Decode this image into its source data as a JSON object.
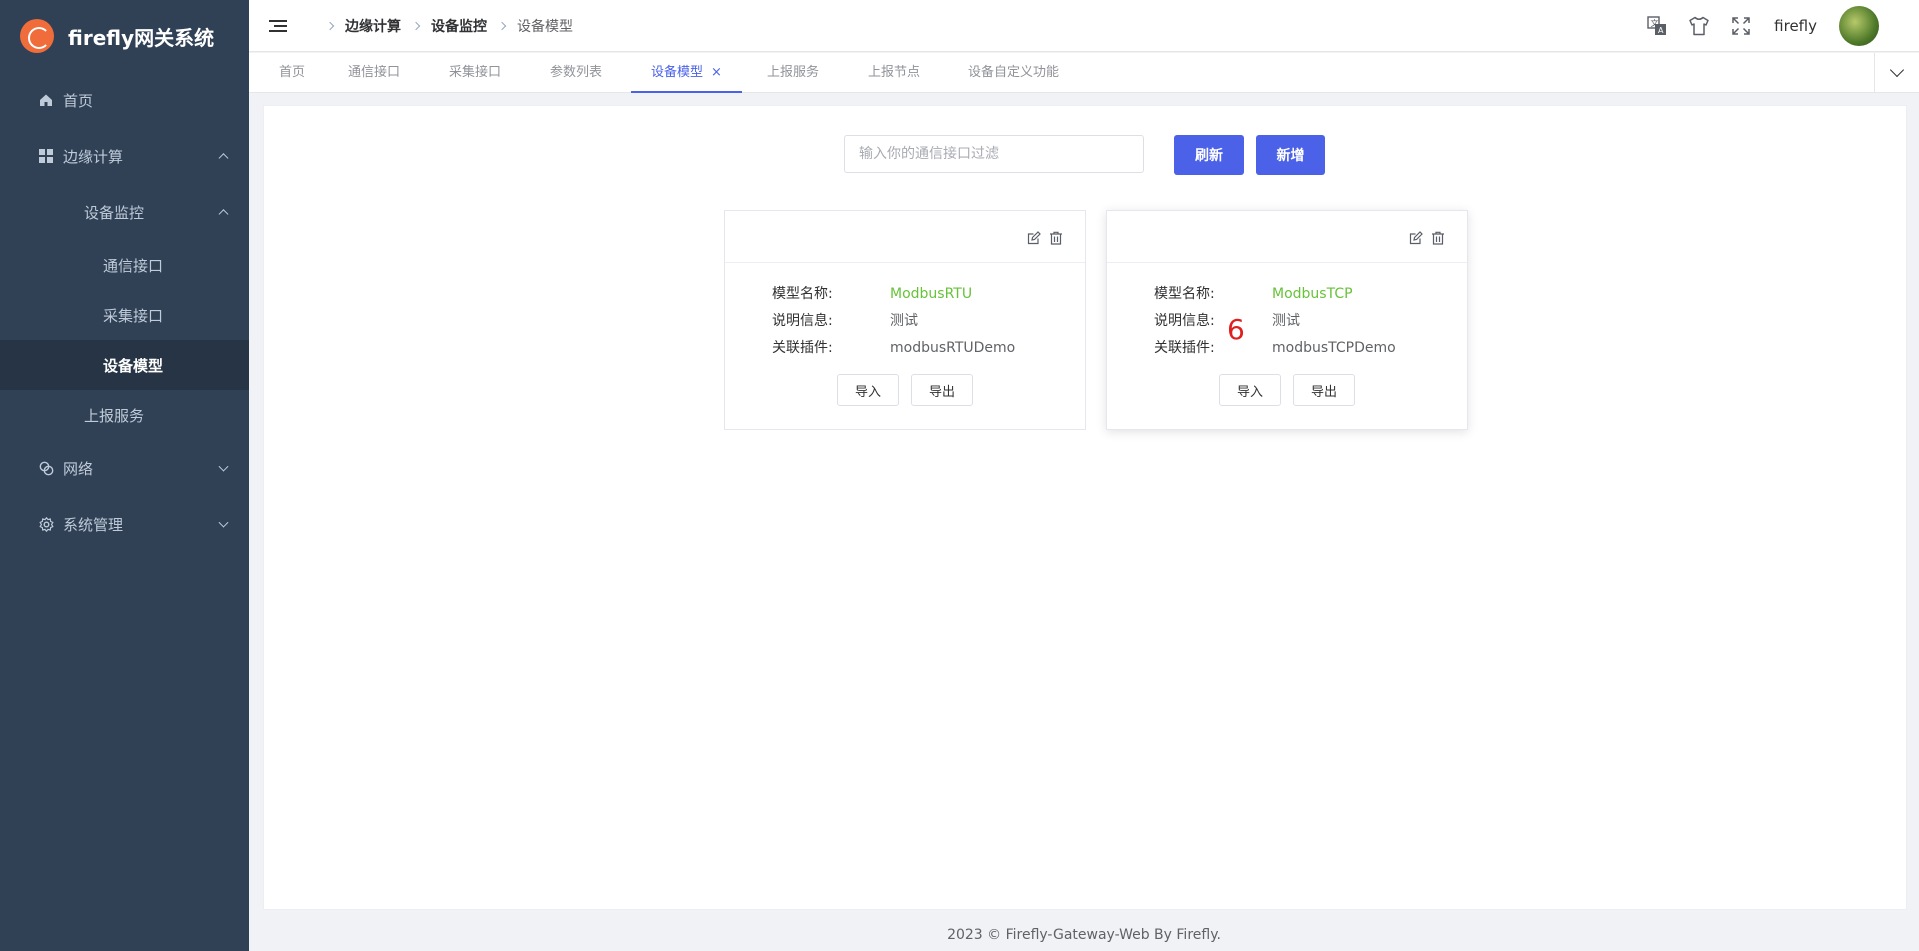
{
  "app": {
    "title": "firefly网关系统"
  },
  "sidebar": {
    "home": "首页",
    "edge": "边缘计算",
    "device_monitor": "设备监控",
    "comm_interface": "通信接口",
    "collect_interface": "采集接口",
    "device_model": "设备模型",
    "report_service": "上报服务",
    "network": "网络",
    "system": "系统管理"
  },
  "breadcrumb": [
    "边缘计算",
    "设备监控",
    "设备模型"
  ],
  "header": {
    "username": "firefly"
  },
  "tabs": [
    "首页",
    "通信接口",
    "采集接口",
    "参数列表",
    "设备模型",
    "上报服务",
    "上报节点",
    "设备自定义功能"
  ],
  "tab_close": "×",
  "toolbar": {
    "filter_placeholder": "输入你的通信接口过滤",
    "refresh": "刷新",
    "add": "新增"
  },
  "field_labels": {
    "name": "模型名称:",
    "desc": "说明信息:",
    "plugin": "关联插件:"
  },
  "card_buttons": {
    "import": "导入",
    "export": "导出"
  },
  "cards": [
    {
      "name": "ModbusRTU",
      "desc": "测试",
      "plugin": "modbusRTUDemo"
    },
    {
      "name": "ModbusTCP",
      "desc": "测试",
      "plugin": "modbusTCPDemo"
    }
  ],
  "annotation": "6",
  "footer": "2023 © Firefly-Gateway-Web By Firefly."
}
